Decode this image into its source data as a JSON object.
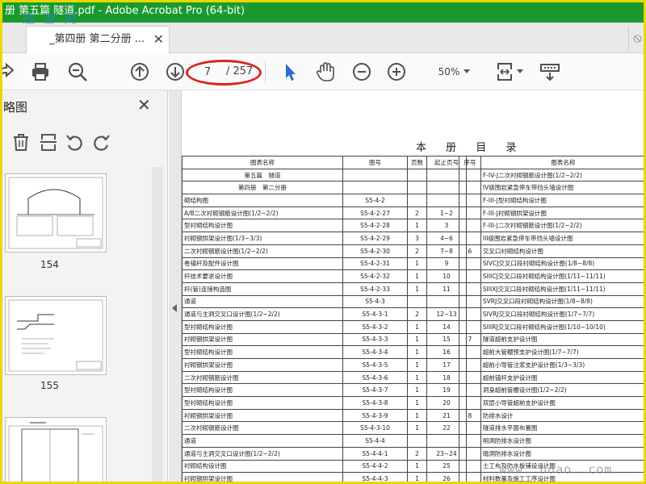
{
  "window": {
    "title": "册 第五篇 隧道.pdf - Adobe Acrobat Pro (64-bit)"
  },
  "watermarks": {
    "top_left": "道 游 网",
    "bottom_right": "www.  bdao.  com"
  },
  "tabs": [
    {
      "label": "_第四册 第二分册 ...",
      "close": "✕"
    }
  ],
  "toolbar": {
    "icons": [
      "share-icon",
      "print-icon",
      "zoom-out-search-icon",
      "page-up-icon",
      "page-down-icon",
      "select-cursor-icon",
      "hand-tool-icon",
      "zoom-out-icon",
      "zoom-in-icon",
      "fit-page-icon",
      "scroll-mode-icon"
    ],
    "current_page": "7",
    "total_pages": "/ 257",
    "zoom": "50%"
  },
  "colors": {
    "titlebar": "#1a9a2e",
    "highlight_ellipse": "#d8261e",
    "frame": "#e8d800",
    "select_tool": "#2a6fd0"
  },
  "thumbnail_panel": {
    "title": "略图",
    "close": "✕",
    "tools": [
      "delete-icon",
      "extract-icon",
      "rotate-left-icon",
      "rotate-right-icon"
    ],
    "thumbnails": [
      {
        "label": "154"
      },
      {
        "label": "155"
      },
      {
        "label": ""
      }
    ]
  },
  "document": {
    "title": "本 册 目 录",
    "left_headers": [
      "图表名称",
      "图号",
      "页数",
      "起止页号"
    ],
    "right_headers": [
      "序号",
      "图表名称"
    ],
    "left_rows": [
      [
        "第五篇　隧道",
        "",
        "",
        ""
      ],
      [
        "第四册　第二分册",
        "",
        "",
        ""
      ],
      [
        "砌结构图",
        "S5-4-2",
        "",
        ""
      ],
      [
        "A/B二次衬砌钢筋设计图(1/2~2/2)",
        "S5-4-2-27",
        "2",
        "1~2"
      ],
      [
        "型衬砌结构设计图",
        "S5-4-2-28",
        "1",
        "3"
      ],
      [
        "衬砌钢拱架设计图(1/3~3/3)",
        "S5-4-2-29",
        "3",
        "4~6"
      ],
      [
        "二次衬砌钢筋设计图(1/2~2/2)",
        "S5-4-2-30",
        "2",
        "7~8"
      ],
      [
        "卷锚杆及配件设计图",
        "S5-4-2-31",
        "1",
        "9"
      ],
      [
        "杆技术要求设计图",
        "S5-4-2-32",
        "1",
        "10"
      ],
      [
        "杆(管)连接构造图",
        "S5-4-2-33",
        "1",
        "11"
      ],
      [
        "通道",
        "S5-4-3",
        "",
        ""
      ],
      [
        "通道与主洞交叉口设计图(1/2~2/2)",
        "S5-4-3-1",
        "2",
        "12~13"
      ],
      [
        "型衬砌结构设计图",
        "S5-4-3-2",
        "1",
        "14"
      ],
      [
        "衬砌钢拱架设计图",
        "S5-4-3-3",
        "1",
        "15"
      ],
      [
        "型衬砌结构设计图",
        "S5-4-3-4",
        "1",
        "16"
      ],
      [
        "衬砌钢拱架设计图",
        "S5-4-3-5",
        "1",
        "17"
      ],
      [
        "二次衬砌钢筋设计图",
        "S5-4-3-6",
        "1",
        "18"
      ],
      [
        "型衬砌结构设计图",
        "S5-4-3-7",
        "1",
        "19"
      ],
      [
        "型衬砌结构设计图",
        "S5-4-3-8",
        "1",
        "20"
      ],
      [
        "衬砌钢拱架设计图",
        "S5-4-3-9",
        "1",
        "21"
      ],
      [
        "二次衬砌钢筋设计图",
        "S5-4-3-10",
        "1",
        "22"
      ],
      [
        "通道",
        "S5-4-4",
        "",
        ""
      ],
      [
        "通道与主洞交叉口设计图(1/2~2/2)",
        "S5-4-4-1",
        "2",
        "23~24"
      ],
      [
        "衬砌结构设计图",
        "S5-4-4-2",
        "1",
        "25"
      ],
      [
        "衬砌钢拱架设计图",
        "S5-4-4-3",
        "1",
        "26"
      ]
    ],
    "right_rows": [
      [
        "",
        "F-IV-J二次衬砌钢筋设计图(1/2~2/2)"
      ],
      [
        "",
        "IV级围岩紧急停车带挡头墙设计图"
      ],
      [
        "",
        "F-III-J型衬砌结构设计图"
      ],
      [
        "",
        "F-III-J衬砌钢拱架设计图"
      ],
      [
        "",
        "F-III-J二次衬砌钢筋设计图(1/2~2/2)"
      ],
      [
        "",
        "III级围岩紧急停车带挡头墙设计图"
      ],
      [
        "6",
        "交叉口衬砌结构设计图"
      ],
      [
        "",
        "SIVCJ交叉口段衬砌结构设计图(1/8~8/8)"
      ],
      [
        "",
        "SIIICJ交叉口段衬砌结构设计图(1/11~11/11)"
      ],
      [
        "",
        "SIIIXJ交叉口段衬砌结构设计图(1/11~11/11)"
      ],
      [
        "",
        "SVRJ交叉口段衬砌结构设计图(1/8~8/8)"
      ],
      [
        "",
        "SIVRJ交叉口段衬砌结构设计图(1/7~7/7)"
      ],
      [
        "",
        "SIIIRJ交叉口段衬砌结构设计图(1/10~10/10)"
      ],
      [
        "7",
        "隧道超前支护设计图"
      ],
      [
        "",
        "超前大管棚预支护设计图(1/7~7/7)"
      ],
      [
        "",
        "超前小导管注浆支护设计图(1/3~3/3)"
      ],
      [
        "",
        "超前锚杆支护设计图"
      ],
      [
        "",
        "洞身超前管棚设计图(1/2~2/2)"
      ],
      [
        "",
        "双层小导管超前支护设计图"
      ],
      [
        "8",
        "防排水设计"
      ],
      [
        "",
        "隧道排水平面布置图"
      ],
      [
        "",
        "明洞防排水设计图"
      ],
      [
        "",
        "暗洞防排水设计图"
      ],
      [
        "",
        "土工布及防水板铺设设计图"
      ],
      [
        "",
        "材料数量及施工工序设计图"
      ]
    ]
  }
}
